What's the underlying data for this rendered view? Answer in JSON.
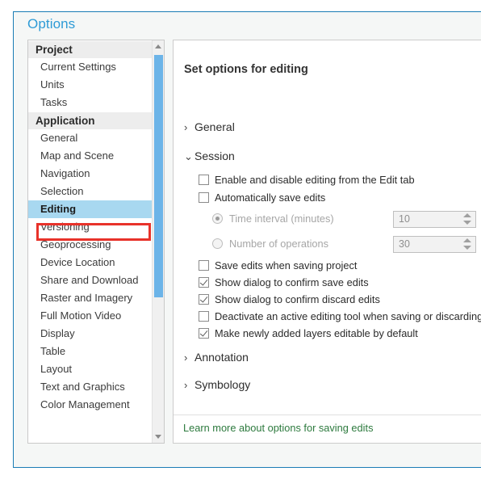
{
  "dialog": {
    "title": "Options",
    "accent_color": "#1a7cb5",
    "title_color": "#2e9bd6"
  },
  "sidebar": {
    "groups": [
      {
        "label": "Project",
        "items": [
          {
            "label": "Current Settings",
            "selected": false
          },
          {
            "label": "Units",
            "selected": false
          },
          {
            "label": "Tasks",
            "selected": false
          }
        ]
      },
      {
        "label": "Application",
        "items": [
          {
            "label": "General",
            "selected": false
          },
          {
            "label": "Map and Scene",
            "selected": false
          },
          {
            "label": "Navigation",
            "selected": false
          },
          {
            "label": "Selection",
            "selected": false
          },
          {
            "label": "Editing",
            "selected": true
          },
          {
            "label": "Versioning",
            "selected": false
          },
          {
            "label": "Geoprocessing",
            "selected": false
          },
          {
            "label": "Device Location",
            "selected": false
          },
          {
            "label": "Share and Download",
            "selected": false
          },
          {
            "label": "Raster and Imagery",
            "selected": false
          },
          {
            "label": "Full Motion Video",
            "selected": false
          },
          {
            "label": "Display",
            "selected": false
          },
          {
            "label": "Table",
            "selected": false
          },
          {
            "label": "Layout",
            "selected": false
          },
          {
            "label": "Text and Graphics",
            "selected": false
          },
          {
            "label": "Color Management",
            "selected": false
          }
        ]
      }
    ],
    "selection_highlight_color": "#a8d8f0",
    "annotation_color": "#e8322a",
    "scrollbar": {
      "thumb_color": "#6cb4e8",
      "track_color": "#f0f0f0"
    }
  },
  "content": {
    "heading": "Set options for editing",
    "sections": [
      {
        "key": "general",
        "label": "General",
        "expanded": false,
        "chevron": "›"
      },
      {
        "key": "session",
        "label": "Session",
        "expanded": true,
        "chevron": "⌄"
      },
      {
        "key": "annotation",
        "label": "Annotation",
        "expanded": false,
        "chevron": "›"
      },
      {
        "key": "symbology",
        "label": "Symbology",
        "expanded": false,
        "chevron": "›"
      }
    ],
    "session": {
      "checkboxes": [
        {
          "key": "enable_disable_edit_tab",
          "label": "Enable and disable editing from the Edit tab",
          "checked": false
        },
        {
          "key": "auto_save_edits",
          "label": "Automatically save edits",
          "checked": false
        },
        {
          "key": "save_edits_with_project",
          "label": "Save edits when saving project",
          "checked": false
        },
        {
          "key": "confirm_save_edits",
          "label": "Show dialog to confirm save edits",
          "checked": true
        },
        {
          "key": "confirm_discard_edits",
          "label": "Show dialog to confirm discard edits",
          "checked": true
        },
        {
          "key": "deactivate_tool",
          "label": "Deactivate an active editing tool when saving or discarding",
          "checked": false
        },
        {
          "key": "new_layers_editable",
          "label": "Make newly added layers editable by default",
          "checked": true
        }
      ],
      "radios": [
        {
          "key": "time_interval",
          "label": "Time interval (minutes)",
          "selected": true,
          "disabled": true,
          "value": "10"
        },
        {
          "key": "number_of_operations",
          "label": "Number of operations",
          "selected": false,
          "disabled": true,
          "value": "30"
        }
      ]
    },
    "footer_link": {
      "label": "Learn more about options for saving edits",
      "color": "#2d7a3e"
    }
  }
}
